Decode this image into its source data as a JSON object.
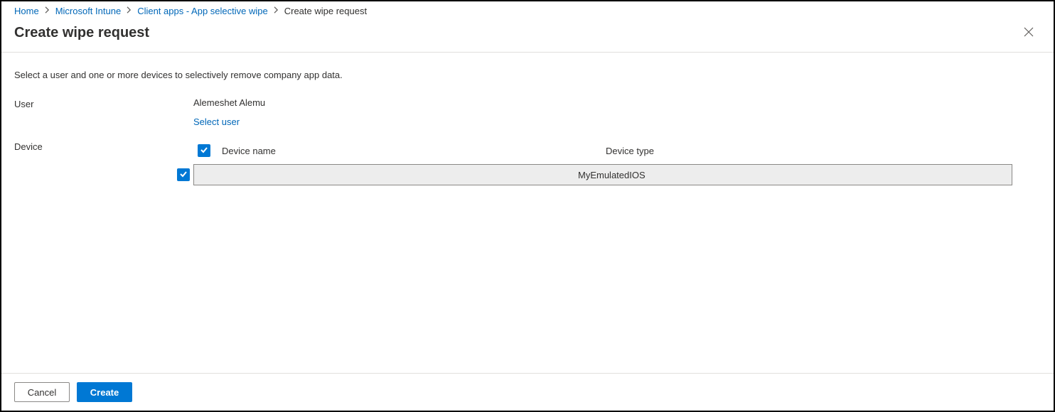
{
  "breadcrumb": {
    "items": [
      {
        "label": "Home",
        "link": true
      },
      {
        "label": "Microsoft Intune",
        "link": true
      },
      {
        "label": "Client apps - App selective wipe",
        "link": true
      },
      {
        "label": "Create wipe request",
        "link": false
      }
    ]
  },
  "header": {
    "title": "Create wipe request"
  },
  "body": {
    "instruction": "Select a user and one or more devices to selectively remove company app data.",
    "user_label": "User",
    "user_value": "Alemeshet Alemu",
    "select_user_link": "Select user",
    "device_label": "Device",
    "device_table": {
      "columns": {
        "name": "Device name",
        "type": "Device type"
      },
      "select_all_checked": true,
      "rows": [
        {
          "checked": true,
          "name": "",
          "type": "MyEmulatedIOS"
        }
      ]
    }
  },
  "footer": {
    "cancel": "Cancel",
    "create": "Create"
  }
}
